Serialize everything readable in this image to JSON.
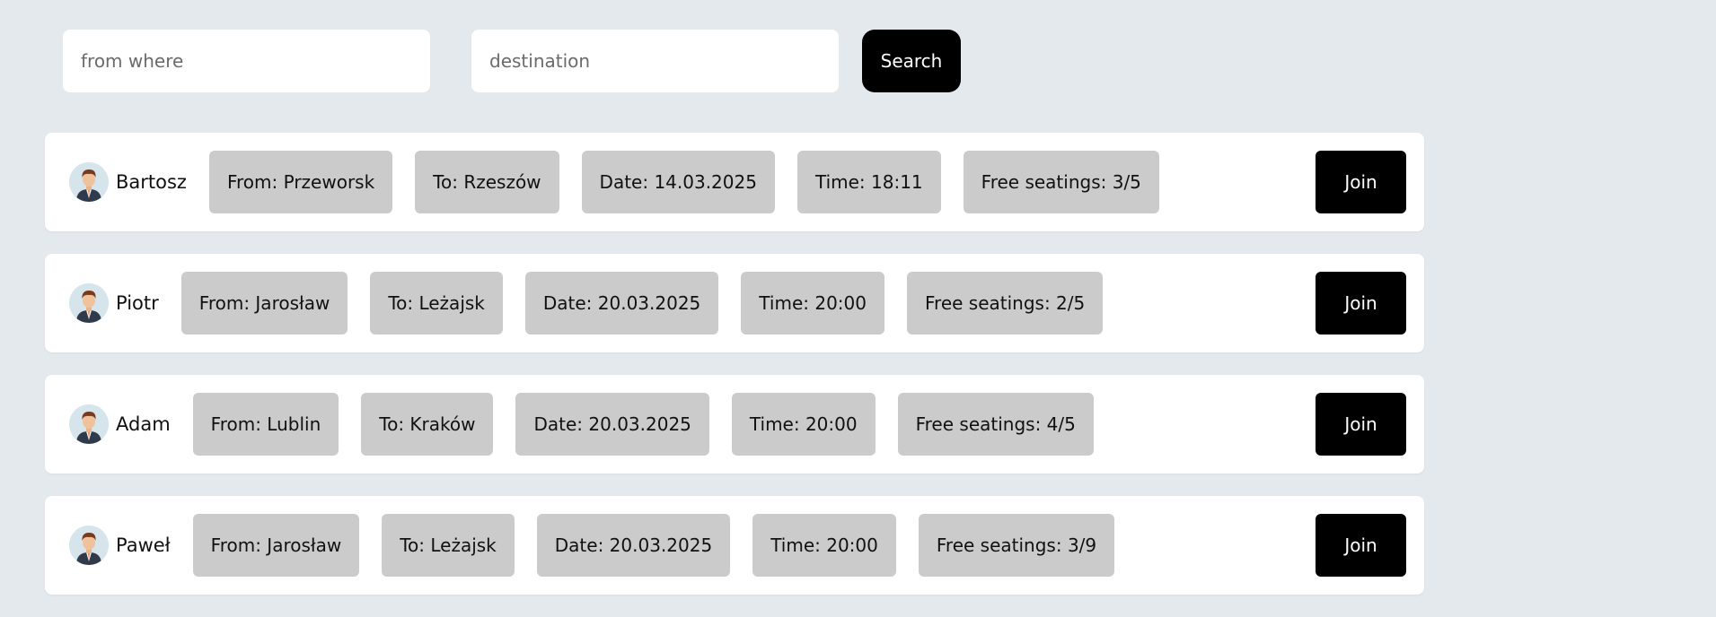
{
  "search": {
    "from_placeholder": "from where",
    "to_placeholder": "destination",
    "button_label": "Search"
  },
  "rides": [
    {
      "driver": "Bartosz",
      "from": "From: Przeworsk",
      "to": "To: Rzeszów",
      "date": "Date: 14.03.2025",
      "time": "Time: 18:11",
      "seats": "Free seatings: 3/5",
      "join_label": "Join"
    },
    {
      "driver": "Piotr",
      "from": "From: Jarosław",
      "to": "To: Leżajsk",
      "date": "Date: 20.03.2025",
      "time": "Time: 20:00",
      "seats": "Free seatings: 2/5",
      "join_label": "Join"
    },
    {
      "driver": "Adam",
      "from": "From: Lublin",
      "to": "To: Kraków",
      "date": "Date: 20.03.2025",
      "time": "Time: 20:00",
      "seats": "Free seatings: 4/5",
      "join_label": "Join"
    },
    {
      "driver": "Paweł",
      "from": "From: Jarosław",
      "to": "To: Leżajsk",
      "date": "Date: 20.03.2025",
      "time": "Time: 20:00",
      "seats": "Free seatings: 3/9",
      "join_label": "Join"
    }
  ],
  "icons": {
    "avatar": "user-avatar-icon"
  },
  "colors": {
    "background": "#e4e9ed",
    "chip": "#cbcbcb",
    "button": "#000000",
    "card": "#ffffff"
  }
}
